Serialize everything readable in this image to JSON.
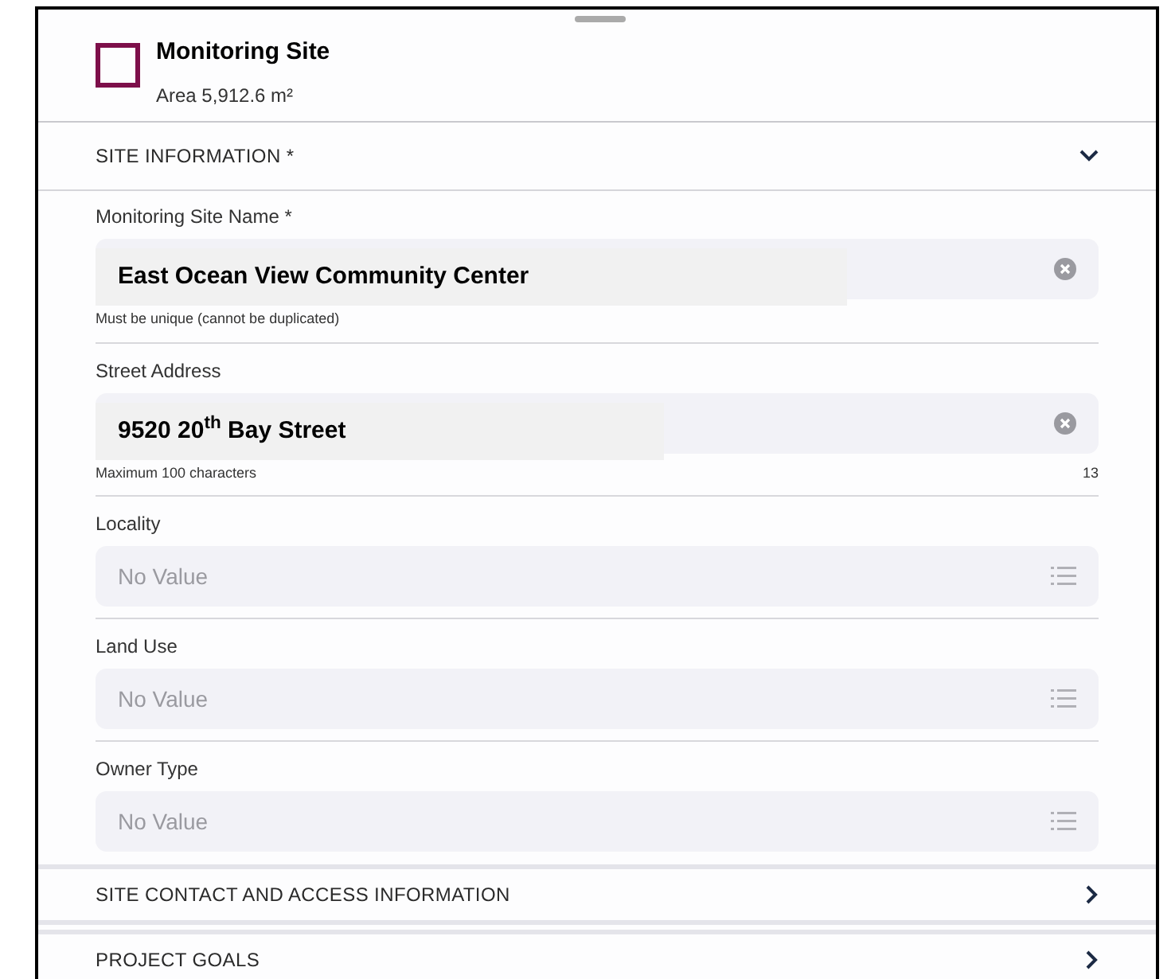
{
  "header": {
    "title": "Monitoring Site",
    "subtitle": "Area 5,912.6 m²"
  },
  "sections": [
    {
      "title": "SITE INFORMATION *",
      "expanded": true,
      "fields": [
        {
          "kind": "text",
          "label": "Monitoring Site Name *",
          "value": "East Ocean View Community Center",
          "helper": "Must be unique (cannot be duplicated)"
        },
        {
          "kind": "text",
          "label": "Street Address",
          "value": "9520 20$^{th}$ Bay Street",
          "helper": "Maximum 100 characters",
          "counter": "13"
        },
        {
          "kind": "select",
          "label": "Locality",
          "placeholder": "No Value"
        },
        {
          "kind": "select",
          "label": "Land Use",
          "placeholder": "No Value"
        },
        {
          "kind": "select",
          "label": "Owner Type",
          "placeholder": "No Value"
        }
      ]
    },
    {
      "title": "SITE CONTACT AND ACCESS INFORMATION",
      "expanded": false
    },
    {
      "title": "PROJECT GOALS",
      "expanded": false
    }
  ]
}
